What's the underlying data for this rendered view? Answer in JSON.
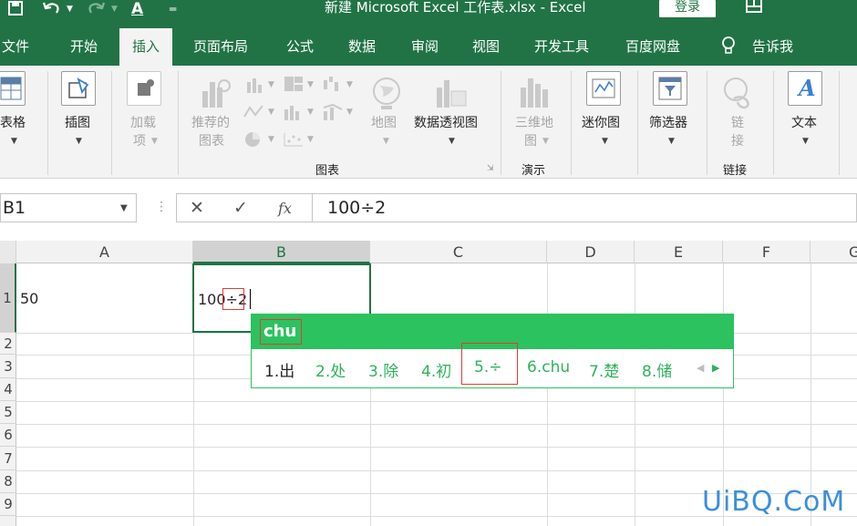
{
  "window": {
    "title": "新建 Microsoft Excel 工作表.xlsx  -  Excel",
    "login_label": "登录",
    "quick_access": [
      "save-icon",
      "undo-icon",
      "redo-icon",
      "font-color-icon",
      "customize-icon"
    ],
    "font_color_letter": "A"
  },
  "tabs": [
    {
      "label": "文件",
      "active": false
    },
    {
      "label": "开始",
      "active": false
    },
    {
      "label": "插入",
      "active": true
    },
    {
      "label": "页面布局",
      "active": false
    },
    {
      "label": "公式",
      "active": false
    },
    {
      "label": "数据",
      "active": false
    },
    {
      "label": "审阅",
      "active": false
    },
    {
      "label": "视图",
      "active": false
    },
    {
      "label": "开发工具",
      "active": false
    },
    {
      "label": "百度网盘",
      "active": false
    },
    {
      "label": "告诉我",
      "active": false
    }
  ],
  "ribbon": {
    "table": "表格",
    "illustrations": "插图",
    "addins_line1": "加载",
    "addins_line2": "项",
    "recommended_charts_line1": "推荐的",
    "recommended_charts_line2": "图表",
    "maps": "地图",
    "pivot_chart": "数据透视图",
    "charts_group": "图表",
    "map3d_line1": "三维地",
    "map3d_line2": "图",
    "tours_group": "演示",
    "sparklines": "迷你图",
    "filters": "筛选器",
    "link_line1": "链",
    "link_line2": "接",
    "links_group": "链接",
    "text": "文本",
    "text_icon_letter": "A"
  },
  "formula_bar": {
    "name_box": "B1",
    "cancel": "✕",
    "enter": "✓",
    "fx": "fx",
    "content": "100÷2"
  },
  "grid": {
    "columns": [
      "A",
      "B",
      "C",
      "D",
      "E",
      "F",
      "G"
    ],
    "rows": [
      "1",
      "2",
      "3",
      "4",
      "5",
      "6",
      "7",
      "8",
      "9"
    ],
    "cells": {
      "A1": "50",
      "B1": "100÷2"
    }
  },
  "ime": {
    "pinyin": "chu",
    "candidates": [
      "1.出",
      "2.处",
      "3.除",
      "4.初",
      "5.÷",
      "6.chu",
      "7.楚",
      "8.储"
    ]
  },
  "watermark": "UiBQ.CoM"
}
